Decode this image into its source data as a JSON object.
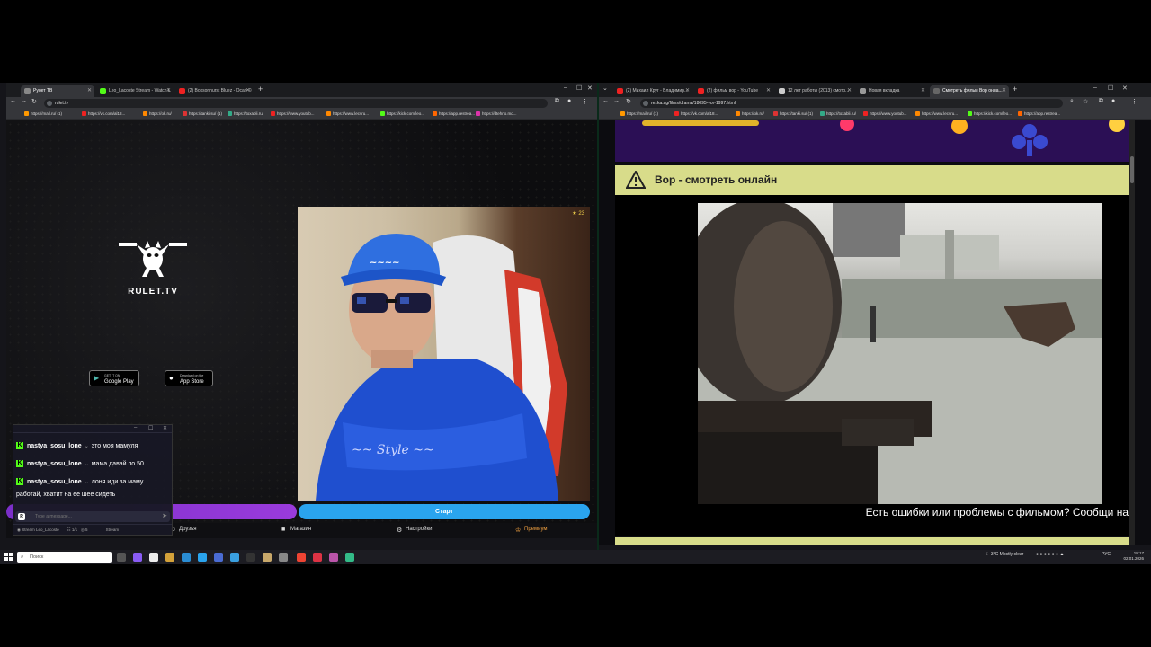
{
  "left_browser": {
    "tabs": [
      "Рулет ТВ",
      "Leo_Lacoste Stream - Watch L",
      "(2) Boxsonhurst Bluez - Ocan ©"
    ],
    "url": "rulet.tv",
    "bookmarks": [
      "https://mail.ru/ (1)",
      "https://vk.com/al18...",
      "https://ok.ru/",
      "https://tanki.su/ (1)",
      "https://toxabli.ru/",
      "https://www.youtub...",
      "https://www.lecsru...",
      "https://kick.com/leo...",
      "https://app.restrea...",
      "https://dtehno.md..."
    ]
  },
  "rulet": {
    "logo_text": "RULET.TV",
    "google_play": {
      "small": "GET IT ON",
      "big": "Google Play"
    },
    "app_store": {
      "small": "Download on the",
      "big": "App Store"
    },
    "viewer_count": "23",
    "start_button": "Старт",
    "nav": {
      "friends": "Друзья",
      "shop": "Магазин",
      "settings": "Настройки",
      "premium": "Премиум"
    }
  },
  "chat": {
    "messages": [
      {
        "user": "nastya_sosu_lone",
        "text": "это моя мамуля"
      },
      {
        "user": "nastya_sosu_lone",
        "text": "мама давай по 50"
      },
      {
        "user": "nastya_sosu_lone",
        "text": "лоня иди за маму"
      }
    ],
    "continuation": "работай, хватит на ее шее сидеть",
    "input_placeholder": "Type a message...",
    "footer_channel": "Stream Leo_Lacoste",
    "footer_counts": "1/1",
    "footer_viewers": "5",
    "footer_extra": "Stream"
  },
  "right_browser": {
    "tabs": [
      "(2) Михаил Круг - Владимир...",
      "(2) фильм вор - YouTube",
      "12 лет работы (2013) смотр...",
      "Новая вкладка",
      "Смотреть фильм Вор онла..."
    ],
    "url": "rezka.ag/films/drama/18095-vor-1997.html",
    "bookmarks": [
      "https://mail.ru/ (1)",
      "https://vk.com/al18...",
      "https://ok.ru/",
      "https://tanki.su/ (1)",
      "https://toxabli.ru/",
      "https://www.youtub...",
      "https://www.lecsru...",
      "https://kick.com/leo...",
      "https://app.restrea..."
    ]
  },
  "rezka": {
    "heading": "Вор - смотреть онлайн",
    "problem_text": "Есть ошибки или проблемы с фильмом? Сообщи на"
  },
  "taskbar": {
    "search_placeholder": "Поиск",
    "weather": "3°C  Mostly clear",
    "lang": "РУС",
    "time": "18:17",
    "date": "02.01.2026"
  },
  "colors": {
    "kick_green": "#53fc18",
    "start_blue": "#2aa4ee",
    "purple": "#8a2be2",
    "rezka_yellow": "#d8dc8a"
  }
}
